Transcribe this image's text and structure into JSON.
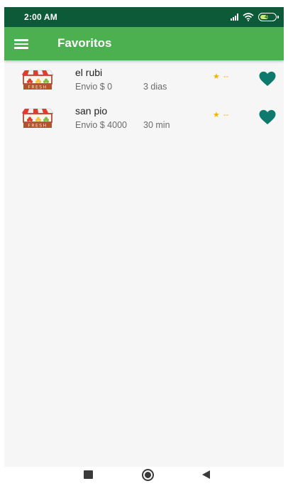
{
  "status_bar": {
    "time": "2:00 AM",
    "battery_level": "40"
  },
  "app_bar": {
    "title": "Favoritos",
    "menu_icon": "hamburger-menu-icon"
  },
  "favorites": [
    {
      "name": "el rubi",
      "shipping": "Envio $ 0",
      "delivery_time": "3 dias",
      "rating": "--",
      "favorited": true
    },
    {
      "name": "san pio",
      "shipping": "Envio $ 4000",
      "delivery_time": "30 min",
      "rating": "--",
      "favorited": true
    }
  ],
  "logo_text": "FRESH",
  "icons": {
    "rating": "star-icon",
    "favorite": "heart-icon",
    "nav_recents": "square-icon",
    "nav_home": "circle-icon",
    "nav_back": "back-triangle-icon"
  },
  "colors": {
    "status_bar": "#0c5a37",
    "app_bar": "#4caf50",
    "heart": "#0e7a6e",
    "star": "#f0b400",
    "background": "#f6f6f6"
  }
}
